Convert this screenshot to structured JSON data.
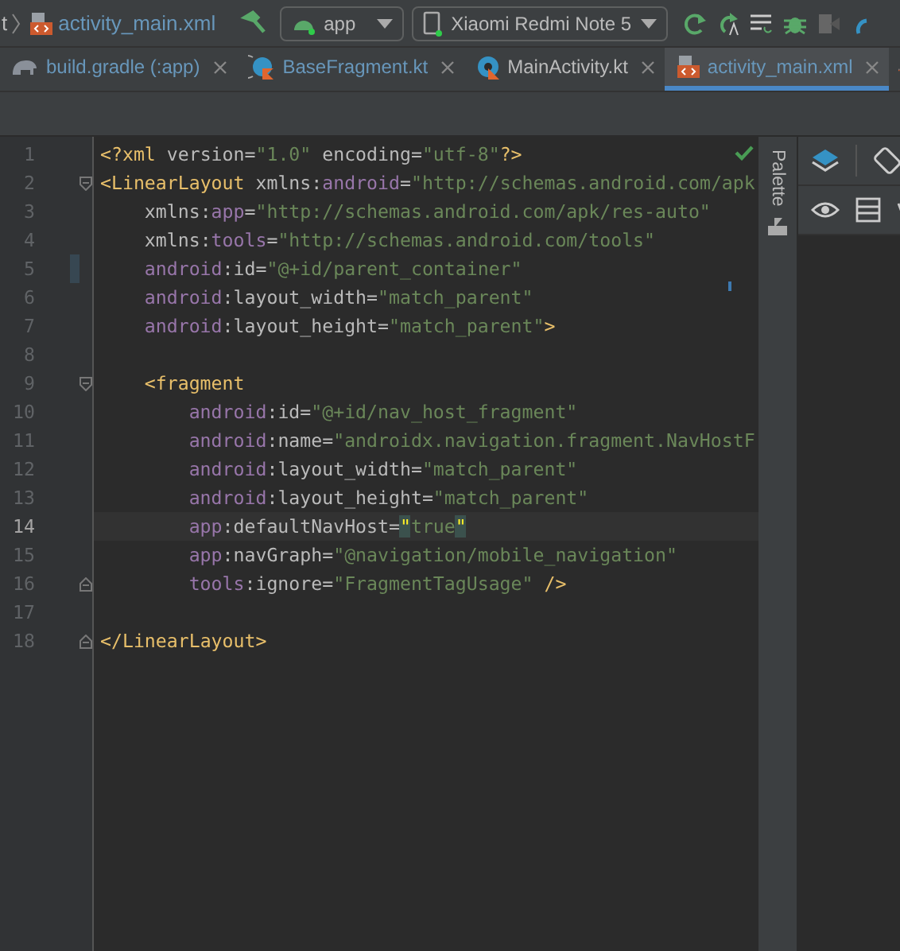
{
  "toolbar": {
    "breadcrumb_previous": "t",
    "file": "activity_main.xml",
    "run_config": "app",
    "device": "Xiaomi Redmi Note 5"
  },
  "tabs": [
    {
      "label": "build.gradle (:app)",
      "kind": "gradle",
      "modified": true,
      "selected": false
    },
    {
      "label": "BaseFragment.kt",
      "kind": "kotlin-class",
      "modified": true,
      "selected": false
    },
    {
      "label": "MainActivity.kt",
      "kind": "kotlin",
      "modified": false,
      "selected": false
    },
    {
      "label": "activity_main.xml",
      "kind": "xml",
      "modified": true,
      "selected": true
    }
  ],
  "editor": {
    "lines": [
      {
        "number": "1",
        "kind": "top",
        "current": false,
        "changed": false,
        "fold_start": false,
        "fold_end": false,
        "tokens": [
          {
            "kind": "tag",
            "text": "<?xml"
          },
          {
            "kind": "attr",
            "text": " version"
          },
          {
            "kind": "punct",
            "text": "="
          },
          {
            "kind": "value",
            "text": "\"1.0\""
          },
          {
            "kind": "attr",
            "text": " encoding"
          },
          {
            "kind": "punct",
            "text": "="
          },
          {
            "kind": "value",
            "text": "\"utf-8\""
          },
          {
            "kind": "tag",
            "text": "?>"
          }
        ]
      },
      {
        "number": "2",
        "kind": "top",
        "current": false,
        "changed": false,
        "fold_start": true,
        "fold_end": false,
        "tokens": [
          {
            "kind": "tag",
            "text": "<LinearLayout"
          },
          {
            "kind": "attr",
            "text": " xmlns"
          },
          {
            "kind": "punct",
            "text": ":"
          },
          {
            "kind": "ns",
            "text": "android"
          },
          {
            "kind": "punct",
            "text": "="
          },
          {
            "kind": "value",
            "text": "\"http://schemas.android.com/apk"
          }
        ]
      },
      {
        "number": "3",
        "kind": "attribute",
        "current": false,
        "changed": false,
        "fold_start": false,
        "fold_end": false,
        "tokens": [
          {
            "kind": "attr",
            "text": "xmlns"
          },
          {
            "kind": "punct",
            "text": ":"
          },
          {
            "kind": "ns",
            "text": "app"
          },
          {
            "kind": "punct",
            "text": "="
          },
          {
            "kind": "value",
            "text": "\"http://schemas.android.com/apk/res-auto\""
          }
        ]
      },
      {
        "number": "4",
        "kind": "attribute",
        "current": false,
        "changed": false,
        "fold_start": false,
        "fold_end": false,
        "tokens": [
          {
            "kind": "attr",
            "text": "xmlns"
          },
          {
            "kind": "punct",
            "text": ":"
          },
          {
            "kind": "ns",
            "text": "tools"
          },
          {
            "kind": "punct",
            "text": "="
          },
          {
            "kind": "value",
            "text": "\"http://schemas.android.com/tools\""
          }
        ]
      },
      {
        "number": "5",
        "kind": "attribute",
        "current": false,
        "changed": true,
        "fold_start": false,
        "fold_end": false,
        "tokens": [
          {
            "kind": "ns",
            "text": "android"
          },
          {
            "kind": "punct",
            "text": ":"
          },
          {
            "kind": "attr",
            "text": "id"
          },
          {
            "kind": "punct",
            "text": "="
          },
          {
            "kind": "value",
            "text": "\"@+id/parent_container\""
          }
        ]
      },
      {
        "number": "6",
        "kind": "attribute",
        "current": false,
        "changed": false,
        "fold_start": false,
        "fold_end": false,
        "tokens": [
          {
            "kind": "ns",
            "text": "android"
          },
          {
            "kind": "punct",
            "text": ":"
          },
          {
            "kind": "attr",
            "text": "layout_width"
          },
          {
            "kind": "punct",
            "text": "="
          },
          {
            "kind": "value",
            "text": "\"match_parent\""
          }
        ]
      },
      {
        "number": "7",
        "kind": "attribute",
        "current": false,
        "changed": false,
        "fold_start": false,
        "fold_end": false,
        "tokens": [
          {
            "kind": "ns",
            "text": "android"
          },
          {
            "kind": "punct",
            "text": ":"
          },
          {
            "kind": "attr",
            "text": "layout_height"
          },
          {
            "kind": "punct",
            "text": "="
          },
          {
            "kind": "value",
            "text": "\"match_parent\""
          },
          {
            "kind": "tag",
            "text": ">"
          }
        ]
      },
      {
        "number": "8",
        "current": false,
        "changed": false,
        "fold_start": false,
        "fold_end": false
      },
      {
        "number": "9",
        "kind": "child",
        "current": false,
        "changed": false,
        "fold_start": true,
        "fold_end": false,
        "tokens": [
          {
            "kind": "tag",
            "text": "<fragment"
          }
        ]
      },
      {
        "number": "10",
        "kind": "child-attribute",
        "current": false,
        "changed": false,
        "fold_start": false,
        "fold_end": false,
        "tokens": [
          {
            "kind": "ns",
            "text": "android"
          },
          {
            "kind": "punct",
            "text": ":"
          },
          {
            "kind": "attr",
            "text": "id"
          },
          {
            "kind": "punct",
            "text": "="
          },
          {
            "kind": "value",
            "text": "\"@+id/nav_host_fragment\""
          }
        ]
      },
      {
        "number": "11",
        "kind": "child-attribute",
        "current": false,
        "changed": false,
        "fold_start": false,
        "fold_end": false,
        "tokens": [
          {
            "kind": "ns",
            "text": "android"
          },
          {
            "kind": "punct",
            "text": ":"
          },
          {
            "kind": "attr",
            "text": "name"
          },
          {
            "kind": "punct",
            "text": "="
          },
          {
            "kind": "value",
            "text": "\"androidx.navigation.fragment.NavHostF"
          }
        ]
      },
      {
        "number": "12",
        "kind": "child-attribute",
        "current": false,
        "changed": false,
        "fold_start": false,
        "fold_end": false,
        "tokens": [
          {
            "kind": "ns",
            "text": "android"
          },
          {
            "kind": "punct",
            "text": ":"
          },
          {
            "kind": "attr",
            "text": "layout_width"
          },
          {
            "kind": "punct",
            "text": "="
          },
          {
            "kind": "value",
            "text": "\"match_parent\""
          }
        ]
      },
      {
        "number": "13",
        "kind": "child-attribute",
        "current": false,
        "changed": false,
        "fold_start": false,
        "fold_end": false,
        "tokens": [
          {
            "kind": "ns",
            "text": "android"
          },
          {
            "kind": "punct",
            "text": ":"
          },
          {
            "kind": "attr",
            "text": "layout_height"
          },
          {
            "kind": "punct",
            "text": "="
          },
          {
            "kind": "value",
            "text": "\"match_parent\""
          }
        ]
      },
      {
        "number": "14",
        "kind": "child-attribute",
        "current": true,
        "changed": false,
        "fold_start": false,
        "fold_end": false,
        "tokens": [
          {
            "kind": "ns",
            "text": "app"
          },
          {
            "kind": "punct",
            "text": ":"
          },
          {
            "kind": "attr",
            "text": "defaultNavHost"
          },
          {
            "kind": "punct",
            "text": "="
          },
          {
            "kind": "match",
            "text": "\""
          },
          {
            "kind": "value",
            "text": "true"
          },
          {
            "kind": "match",
            "text": "\""
          }
        ]
      },
      {
        "number": "15",
        "kind": "child-attribute",
        "current": false,
        "changed": false,
        "fold_start": false,
        "fold_end": false,
        "tokens": [
          {
            "kind": "ns",
            "text": "app"
          },
          {
            "kind": "punct",
            "text": ":"
          },
          {
            "kind": "attr",
            "text": "navGraph"
          },
          {
            "kind": "punct",
            "text": "="
          },
          {
            "kind": "value",
            "text": "\"@navigation/mobile_navigation\""
          }
        ]
      },
      {
        "number": "16",
        "kind": "child-attribute",
        "current": false,
        "changed": false,
        "fold_start": false,
        "fold_end": true,
        "tokens": [
          {
            "kind": "ns",
            "text": "tools"
          },
          {
            "kind": "punct",
            "text": ":"
          },
          {
            "kind": "attr",
            "text": "ignore"
          },
          {
            "kind": "punct",
            "text": "="
          },
          {
            "kind": "value",
            "text": "\"FragmentTagUsage\""
          },
          {
            "kind": "tag",
            "text": " />"
          }
        ]
      },
      {
        "number": "17",
        "current": false,
        "changed": false,
        "fold_start": false,
        "fold_end": false
      },
      {
        "number": "18",
        "kind": "top",
        "current": false,
        "changed": false,
        "fold_start": false,
        "fold_end": true,
        "tokens": [
          {
            "kind": "tag",
            "text": "</LinearLayout>"
          }
        ]
      }
    ]
  },
  "side_panel": {
    "title": "Palette"
  }
}
